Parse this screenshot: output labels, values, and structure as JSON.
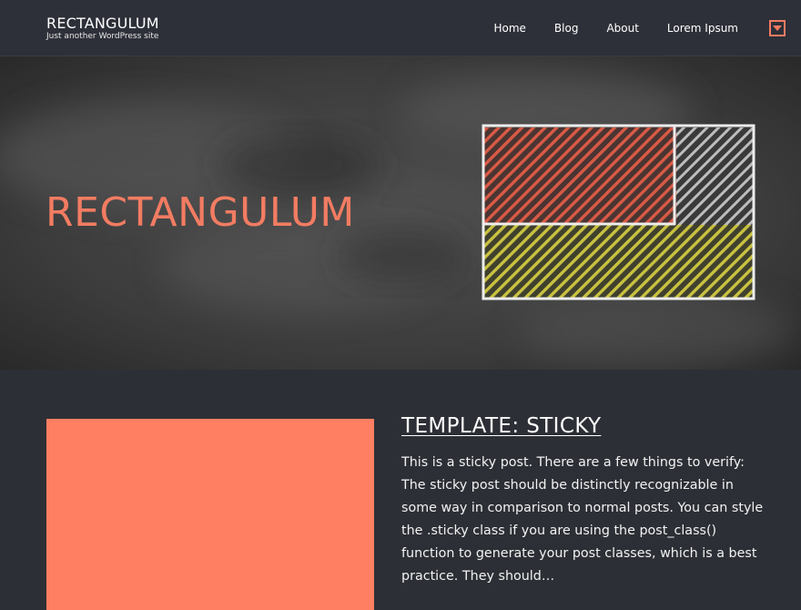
{
  "header": {
    "site_title": "RECTANGULUM",
    "tagline": "Just another WordPress site",
    "nav": [
      {
        "label": "Home"
      },
      {
        "label": "Blog"
      },
      {
        "label": "About"
      },
      {
        "label": "Lorem Ipsum"
      }
    ],
    "menu_toggle_icon": "caret-down-icon"
  },
  "hero": {
    "title": "RECTANGULUM",
    "image": "chalkboard-rectangle-illustration"
  },
  "post": {
    "title": "TEMPLATE: STICKY",
    "excerpt": "This is a sticky post. There are a few things to verify: The sticky post should be distinctly recognizable in some way in comparison to normal posts. You can style the .sticky class if you are using the post_class() function to generate your post classes, which is a best practice. They should…"
  },
  "colors": {
    "accent": "#f27c62",
    "featured_image": "#ff7f62",
    "background": "#2d2f36",
    "chalk_red": "#d95a45",
    "chalk_yellow": "#c9c240",
    "chalk_white": "#e8e8e8"
  }
}
